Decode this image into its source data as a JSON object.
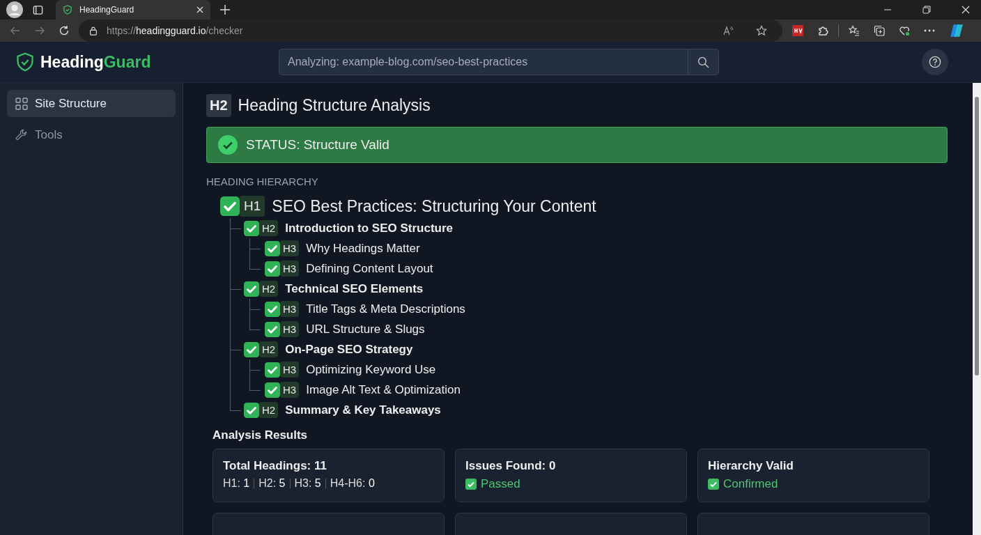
{
  "browser": {
    "tab_title": "HeadingGuard",
    "url": {
      "scheme": "https://",
      "host": "headingguard.io",
      "path": "/checker"
    }
  },
  "app": {
    "logo": {
      "first": "Heading",
      "second": "Guard"
    },
    "search": {
      "placeholder": "Analyzing: example-blog.com/seo-best-practices"
    }
  },
  "sidebar": {
    "items": [
      {
        "label": "Site Structure",
        "kind": "grid",
        "selected": true
      },
      {
        "label": "Tools",
        "kind": "wrench",
        "selected": false
      }
    ]
  },
  "page": {
    "badge": "H2",
    "title": "Heading Structure Analysis"
  },
  "status": {
    "text": "STATUS: Structure Valid",
    "valid": true
  },
  "hierarchy": {
    "label": "HEADING HIERARCHY",
    "tree": [
      {
        "tag": "H1",
        "text": "SEO Best Practices: Structuring Your Content",
        "checked": true,
        "children": [
          {
            "tag": "H2",
            "text": "Introduction to SEO Structure",
            "checked": true,
            "children": [
              {
                "tag": "H3",
                "text": "Why Headings Matter",
                "checked": true
              },
              {
                "tag": "H3",
                "text": "Defining Content Layout",
                "checked": true
              }
            ]
          },
          {
            "tag": "H2",
            "text": "Technical SEO Elements",
            "checked": true,
            "children": [
              {
                "tag": "H3",
                "text": "Title Tags & Meta Descriptions",
                "checked": true
              },
              {
                "tag": "H3",
                "text": "URL Structure & Slugs",
                "checked": true
              }
            ]
          },
          {
            "tag": "H2",
            "text": "On-Page SEO Strategy",
            "checked": true,
            "children": [
              {
                "tag": "H3",
                "text": "Optimizing Keyword Use",
                "checked": true
              },
              {
                "tag": "H3",
                "text": "Image Alt Text & Optimization",
                "checked": true
              }
            ]
          },
          {
            "tag": "H2",
            "text": "Summary & Key Takeaways",
            "checked": true
          }
        ]
      }
    ]
  },
  "results": {
    "title": "Analysis Results",
    "cards": [
      {
        "kind": "counts",
        "title": "Total Headings: 11",
        "counts": [
          {
            "label": "H1:",
            "value": "1"
          },
          {
            "label": "H2:",
            "value": "5"
          },
          {
            "label": "H3:",
            "value": "5"
          },
          {
            "label": "H4-H6:",
            "value": "0"
          }
        ]
      },
      {
        "kind": "status",
        "title": "Issues Found: 0",
        "status": "Passed",
        "checked": true
      },
      {
        "kind": "status",
        "title": "Hierarchy Valid",
        "status": "Confirmed",
        "checked": true
      },
      {
        "kind": "empty"
      },
      {
        "kind": "empty"
      },
      {
        "kind": "empty"
      }
    ]
  }
}
